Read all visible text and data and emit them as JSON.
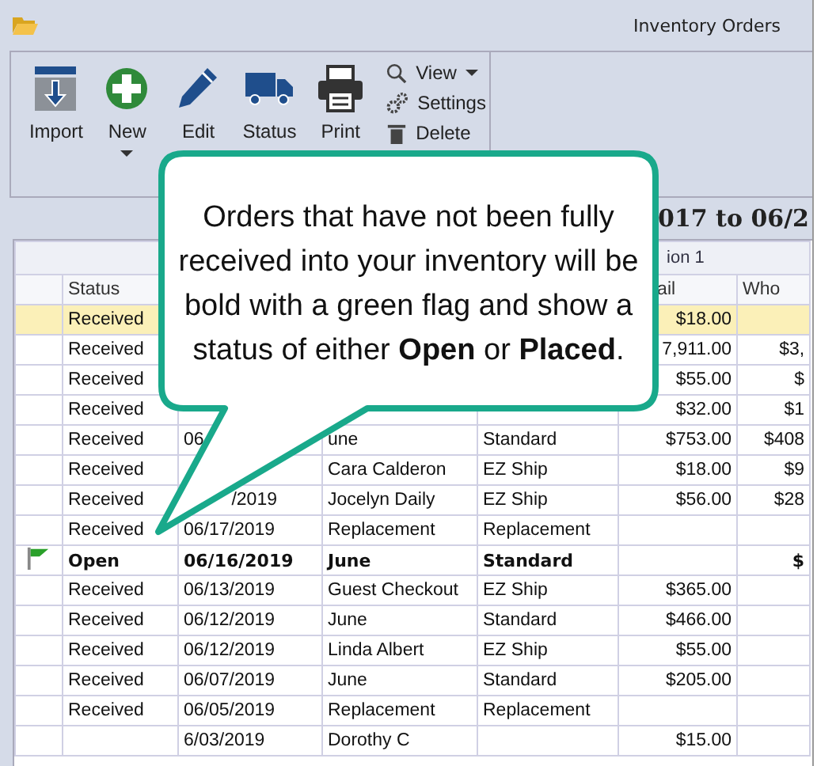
{
  "window": {
    "title": "Inventory Orders"
  },
  "ribbon": {
    "large_buttons": [
      {
        "kind": "import",
        "label": "Import",
        "dropdown": false
      },
      {
        "kind": "new",
        "label": "New",
        "dropdown": true
      },
      {
        "kind": "edit",
        "label": "Edit",
        "dropdown": false
      },
      {
        "kind": "status",
        "label": "Status",
        "dropdown": false
      },
      {
        "kind": "print",
        "label": "Print",
        "dropdown": false
      }
    ],
    "small_buttons": [
      {
        "kind": "view",
        "label": "View",
        "dropdown": true
      },
      {
        "kind": "settings",
        "label": "Settings",
        "dropdown": false
      },
      {
        "kind": "delete",
        "label": "Delete",
        "dropdown": false
      }
    ]
  },
  "date_range": "017 to 06/2",
  "table": {
    "band": "ion 1",
    "columns": [
      "Status",
      "",
      "",
      "",
      "ail",
      "Who"
    ],
    "rows": [
      {
        "selected": true,
        "flagged": false,
        "cells": [
          "Received",
          "",
          "",
          "",
          "$18.00",
          ""
        ]
      },
      {
        "selected": false,
        "flagged": false,
        "cells": [
          "Received",
          "",
          "",
          "",
          "7,911.00",
          "$3,"
        ]
      },
      {
        "selected": false,
        "flagged": false,
        "cells": [
          "Received",
          "",
          "",
          "",
          "$55.00",
          "$"
        ]
      },
      {
        "selected": false,
        "flagged": false,
        "cells": [
          "Received",
          "",
          "",
          "",
          "$32.00",
          "$1"
        ]
      },
      {
        "selected": false,
        "flagged": false,
        "cells": [
          "Received",
          "06",
          "une",
          "Standard",
          "$753.00",
          "$408"
        ]
      },
      {
        "selected": false,
        "flagged": false,
        "cells": [
          "Received",
          "",
          "Cara Calderon",
          "EZ Ship",
          "$18.00",
          "$9"
        ]
      },
      {
        "selected": false,
        "flagged": false,
        "cells": [
          "Received",
          "/2019",
          "Jocelyn Daily",
          "EZ Ship",
          "$56.00",
          "$28"
        ]
      },
      {
        "selected": false,
        "flagged": false,
        "cells": [
          "Received",
          "06/17/2019",
          "Replacement",
          "Replacement",
          "",
          ""
        ]
      },
      {
        "selected": false,
        "flagged": true,
        "cells": [
          "Open",
          "06/16/2019",
          "June",
          "Standard",
          "",
          "$"
        ]
      },
      {
        "selected": false,
        "flagged": false,
        "cells": [
          "Received",
          "06/13/2019",
          "Guest  Checkout",
          "EZ Ship",
          "$365.00",
          ""
        ]
      },
      {
        "selected": false,
        "flagged": false,
        "cells": [
          "Received",
          "06/12/2019",
          "June",
          "Standard",
          "$466.00",
          ""
        ]
      },
      {
        "selected": false,
        "flagged": false,
        "cells": [
          "Received",
          "06/12/2019",
          "Linda Albert",
          "EZ Ship",
          "$55.00",
          ""
        ]
      },
      {
        "selected": false,
        "flagged": false,
        "cells": [
          "Received",
          "06/07/2019",
          "June",
          "Standard",
          "$205.00",
          ""
        ]
      },
      {
        "selected": false,
        "flagged": false,
        "cells": [
          "Received",
          "06/05/2019",
          "Replacement",
          "Replacement",
          "",
          ""
        ]
      },
      {
        "selected": false,
        "flagged": false,
        "cells": [
          "",
          "6/03/2019",
          "Dorothy C",
          "",
          "$15.00",
          ""
        ]
      }
    ]
  },
  "callout": {
    "text": "Orders that have not been fully received into your inventory will be bold with a green flag and show a status of either **Open** or **Placed**."
  }
}
